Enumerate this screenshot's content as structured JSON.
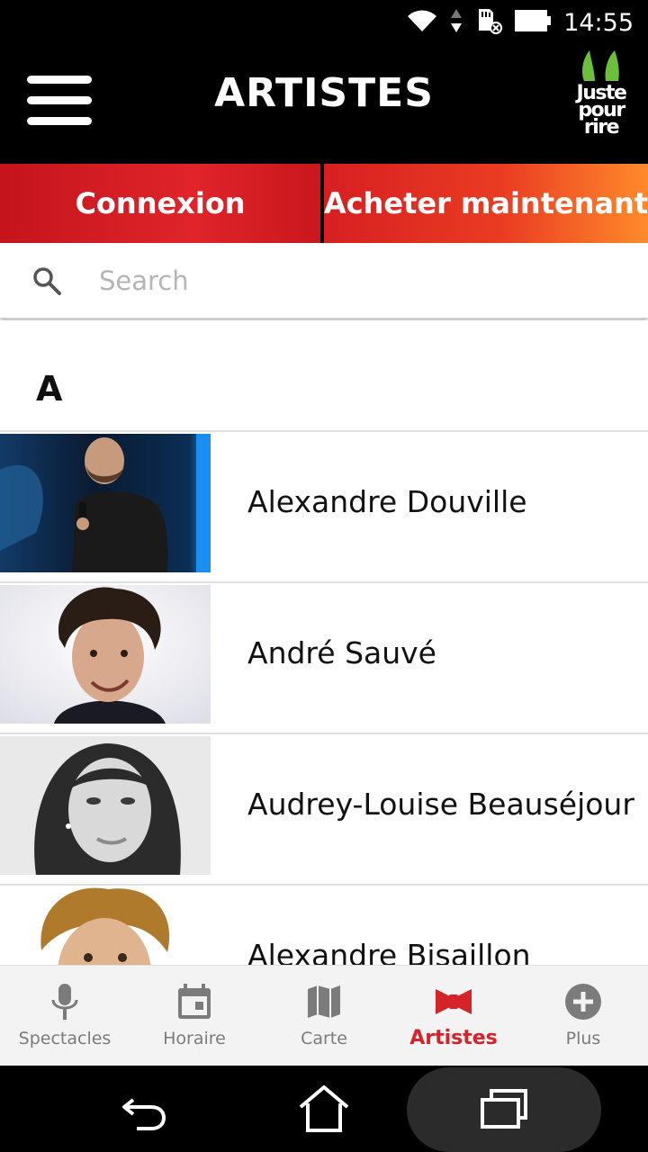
{
  "status_bar": {
    "time": "14:55"
  },
  "header": {
    "title": "ARTISTES",
    "logo_text_lines": [
      "Juste",
      "pour",
      "rire"
    ]
  },
  "actions": {
    "login_label": "Connexion",
    "buy_label": "Acheter maintenant"
  },
  "search": {
    "placeholder": "Search"
  },
  "list": {
    "section_letter": "A",
    "artists": [
      {
        "name": "Alexandre Douville",
        "photo": "stage-photo-bald-man-microphone"
      },
      {
        "name": "André Sauvé",
        "photo": "portrait-curly-hair-smiling-man"
      },
      {
        "name": "Audrey-Louise Beauséjour",
        "photo": "portrait-woman-black-and-white"
      },
      {
        "name": "Alexandre Bisaillon",
        "photo": "portrait-curly-hair-laughing-man"
      }
    ]
  },
  "bottom_nav": {
    "items": [
      {
        "label": "Spectacles",
        "icon": "microphone-icon",
        "active": false
      },
      {
        "label": "Horaire",
        "icon": "calendar-icon",
        "active": false
      },
      {
        "label": "Carte",
        "icon": "map-icon",
        "active": false
      },
      {
        "label": "Artistes",
        "icon": "bow-tie-icon",
        "active": true
      },
      {
        "label": "Plus",
        "icon": "plus-circle-icon",
        "active": false
      }
    ]
  },
  "colors": {
    "accent_red": "#d5232a",
    "header_bg": "#000000",
    "brand_green": "#6bbf3a",
    "inactive_gray": "#7b7b7b"
  }
}
